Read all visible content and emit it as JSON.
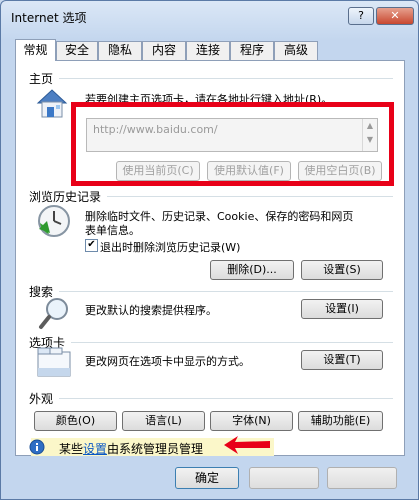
{
  "window": {
    "title": "Internet 选项",
    "help_label": "?",
    "close_label": "✕"
  },
  "tabs": [
    {
      "label": "常规",
      "active": true
    },
    {
      "label": "安全"
    },
    {
      "label": "隐私"
    },
    {
      "label": "内容"
    },
    {
      "label": "连接"
    },
    {
      "label": "程序"
    },
    {
      "label": "高级"
    }
  ],
  "home": {
    "section_title": "主页",
    "description": "若要创建主页选项卡，请在各地址行键入地址(R)。",
    "url_value": "http://www.baidu.com/",
    "btn_current": "使用当前页(C)",
    "btn_default": "使用默认值(F)",
    "btn_blank": "使用空白页(B)",
    "icon": "house-icon"
  },
  "history": {
    "section_title": "浏览历史记录",
    "description_line1": "删除临时文件、历史记录、Cookie、保存的密码和网页",
    "description_line2": "表单信息。",
    "checkbox_label": "退出时删除浏览历史记录(W)",
    "checkbox_checked": true,
    "btn_delete": "删除(D)...",
    "btn_settings": "设置(S)",
    "icon": "history-clock-icon"
  },
  "search": {
    "section_title": "搜索",
    "description": "更改默认的搜索提供程序。",
    "btn_settings": "设置(I)",
    "icon": "magnifier-icon"
  },
  "tabs_section": {
    "section_title": "选项卡",
    "description": "更改网页在选项卡中显示的方式。",
    "btn_settings": "设置(T)",
    "icon": "tabs-window-icon"
  },
  "appearance": {
    "section_title": "外观",
    "btn_colors": "颜色(O)",
    "btn_languages": "语言(L)",
    "btn_fonts": "字体(N)",
    "btn_accessibility": "辅助功能(E)"
  },
  "info": {
    "prefix": "某些",
    "link": "设置",
    "suffix": "由系统管理员管理",
    "icon": "info-icon"
  },
  "footer": {
    "ok_label": "确定"
  },
  "colors": {
    "highlight": "#e80018",
    "link": "#0b58c4",
    "info_bg": "#fbf7c9"
  }
}
